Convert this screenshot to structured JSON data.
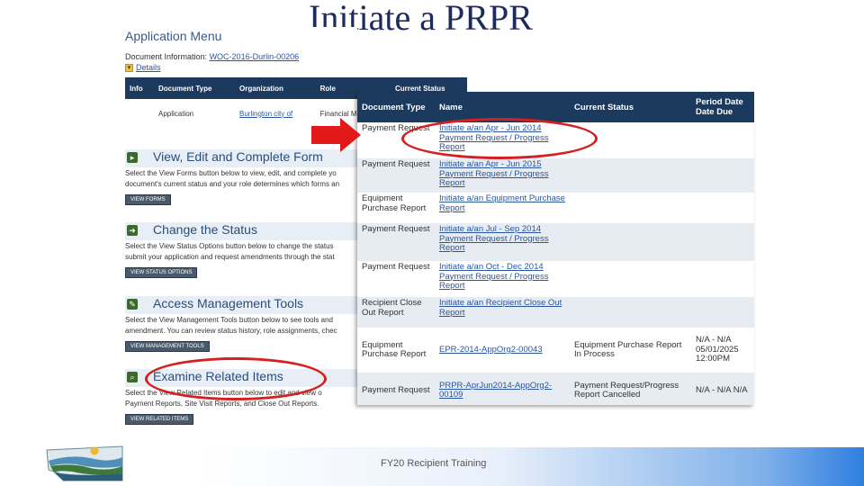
{
  "slide": {
    "title": "Initiate a PRPR",
    "footer": "FY20 Recipient Training"
  },
  "app": {
    "menu_title": "Application Menu",
    "doc_info_label": "Document Information:",
    "doc_info_link": "WOC-2016-Durlin-00206",
    "details_label": "Details",
    "table_headers": [
      "Info",
      "Document Type",
      "Organization",
      "Role",
      "Current Status"
    ],
    "table_row": [
      "",
      "Application",
      "Burlington city of",
      "Financial Mana",
      ""
    ],
    "sections": [
      {
        "title": "View, Edit and Complete Form",
        "desc1": "Select the View Forms button below to view, edit, and complete yo",
        "desc2": "document's current status and your role determines which forms an",
        "button": "VIEW FORMS"
      },
      {
        "title": "Change the Status",
        "desc1": "Select the View Status Options button below to change the status",
        "desc2": "submit your application and request amendments through the stat",
        "button": "VIEW STATUS OPTIONS"
      },
      {
        "title": "Access Management Tools",
        "desc1": "Select the View Management Tools button below to see tools and",
        "desc2": "amendment. You can review status history, role assignments, chec",
        "button": "VIEW MANAGEMENT TOOLS"
      },
      {
        "title": "Examine Related Items",
        "desc1": "Select the View Related Items button below to edit and view o",
        "desc2": "Payment Reports, Site Visit Reports, and Close Out Reports.",
        "button": "VIEW RELATED ITEMS"
      }
    ]
  },
  "docs": {
    "headers": {
      "type": "Document Type",
      "name": "Name",
      "status": "Current Status",
      "due": "Period Date Date Due"
    },
    "rows": [
      {
        "type": "Payment Request",
        "name": "Initiate a/an Apr - Jun 2014 Payment Request / Progress Report",
        "status": "",
        "due": ""
      },
      {
        "type": "Payment Request",
        "name": "Initiate a/an Apr - Jun 2015 Payment Request / Progress Report",
        "status": "",
        "due": ""
      },
      {
        "type": "Equipment Purchase Report",
        "name": "Initiate a/an Equipment Purchase Report",
        "status": "",
        "due": ""
      },
      {
        "type": "Payment Request",
        "name": "Initiate a/an Jul - Sep 2014 Payment Request / Progress Report",
        "status": "",
        "due": ""
      },
      {
        "type": "Payment Request",
        "name": "Initiate a/an Oct - Dec 2014 Payment Request / Progress Report",
        "status": "",
        "due": ""
      },
      {
        "type": "Recipient Close Out Report",
        "name": "Initiate a/an Recipient Close Out Report",
        "status": "",
        "due": ""
      },
      {
        "type": "Equipment Purchase Report",
        "name": "EPR-2014-AppOrg2-00043",
        "status": "Equipment Purchase Report In Process",
        "due": "N/A - N/A 05/01/2025 12:00PM"
      },
      {
        "type": "Payment Request",
        "name": "PRPR-AprJun2014-AppOrg2-00109",
        "status": "Payment Request/Progress Report Cancelled",
        "due": "N/A - N/A N/A"
      }
    ]
  },
  "colors": {
    "header_navy": "#1c3a5e",
    "highlight_red": "#d42020",
    "link_blue": "#2a56a0"
  }
}
